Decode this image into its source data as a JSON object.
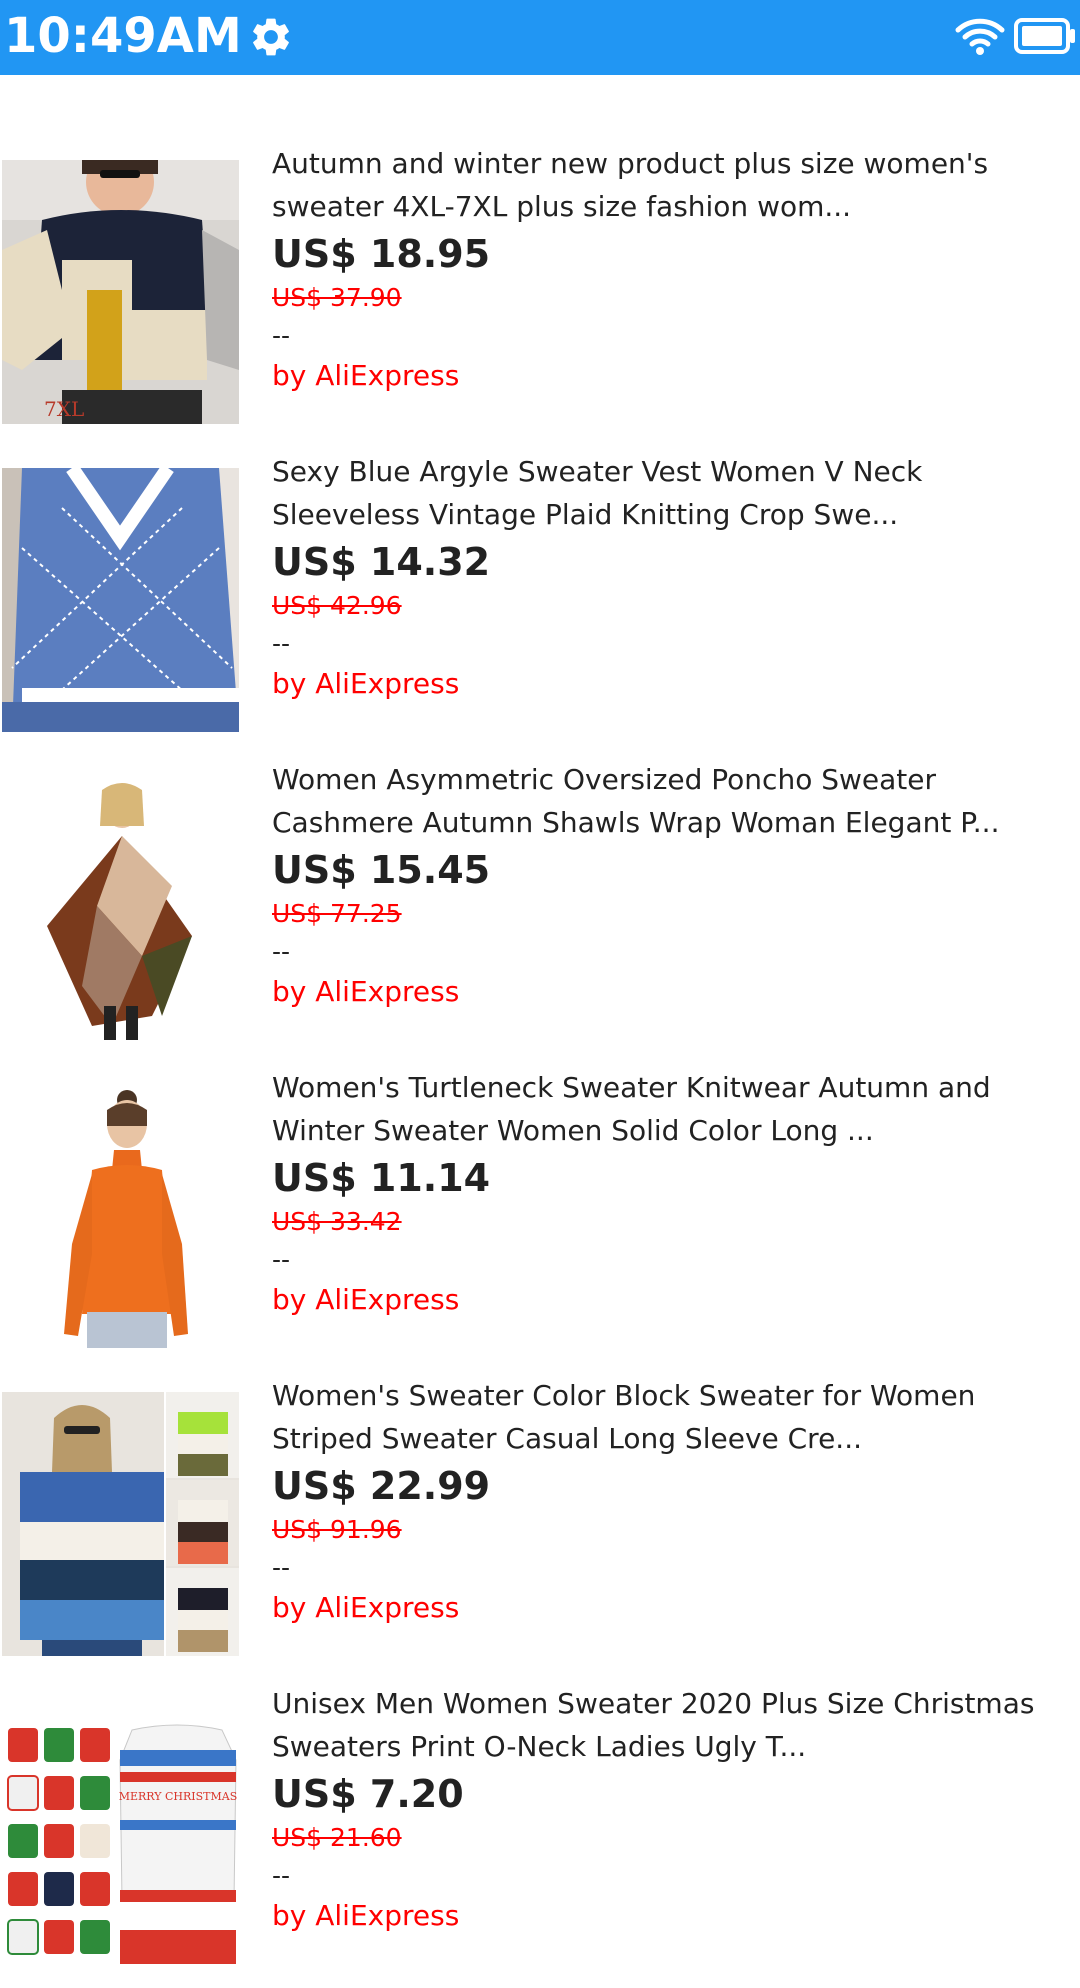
{
  "status_bar": {
    "time": "10:49AM",
    "icons": [
      "gear-icon",
      "wifi-icon",
      "battery-icon"
    ],
    "background": "#2196F3"
  },
  "products": [
    {
      "title": "Autumn and winter new product plus size women's sweater 4XL-7XL plus size fashion wom...",
      "price": "US$ 18.95",
      "original_price": "US$ 37.90",
      "rating": "--",
      "seller": "by AliExpress",
      "image_label": "7XL"
    },
    {
      "title": "Sexy Blue Argyle Sweater Vest Women V Neck Sleeveless Vintage Plaid Knitting Crop Swe...",
      "price": "US$ 14.32",
      "original_price": "US$ 42.96",
      "rating": "--",
      "seller": "by AliExpress"
    },
    {
      "title": "Women Asymmetric Oversized Poncho Sweater Cashmere Autumn Shawls Wrap Woman Elegant P...",
      "price": "US$ 15.45",
      "original_price": "US$ 77.25",
      "rating": "--",
      "seller": "by AliExpress"
    },
    {
      "title": "Women's Turtleneck Sweater Knitwear Autumn and Winter Sweater Women Solid Color Long ...",
      "price": "US$ 11.14",
      "original_price": "US$ 33.42",
      "rating": "--",
      "seller": "by AliExpress"
    },
    {
      "title": "Women's Sweater Color Block Sweater for Women Striped Sweater Casual Long Sleeve Cre...",
      "price": "US$ 22.99",
      "original_price": "US$ 91.96",
      "rating": "--",
      "seller": "by AliExpress"
    },
    {
      "title": "Unisex Men Women Sweater 2020 Plus Size Christmas Sweaters Print O-Neck Ladies Ugly T...",
      "price": "US$ 7.20",
      "original_price": "US$ 21.60",
      "rating": "--",
      "seller": "by AliExpress",
      "image_label": "MERRY CHRISTMAS"
    }
  ],
  "colors": {
    "accent": "#2196F3",
    "sale_red": "#FF0000",
    "text": "#222222"
  }
}
